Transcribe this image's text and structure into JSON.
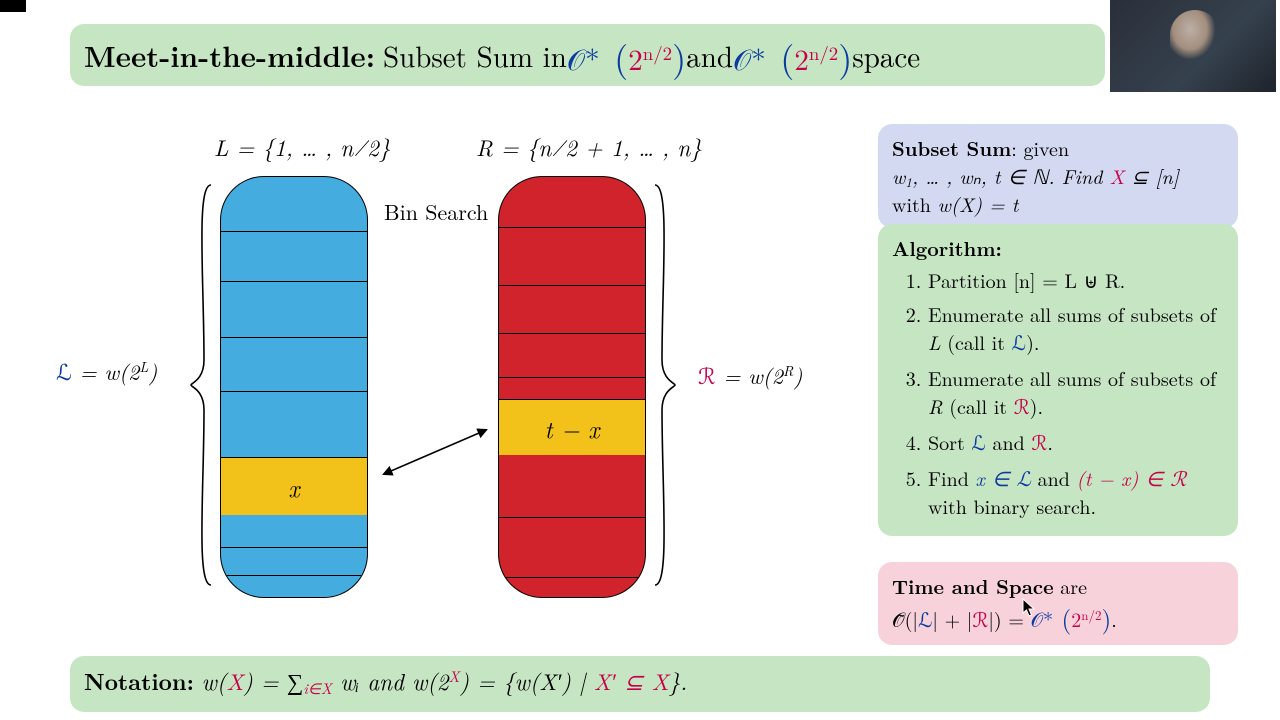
{
  "title": {
    "bold": "Meet-in-the-middle:",
    "rest_1": " Subset Sum in ",
    "o1": "𝒪*",
    "exp1": "2",
    "exp1sup": "n/2",
    "and": " and ",
    "o2": "𝒪*",
    "exp2": "2",
    "exp2sup": "n/2",
    "space": " space"
  },
  "diagram": {
    "L_label": "L = {1, … , n⁄2}",
    "R_label": "R = {n⁄2 + 1, … , n}",
    "bin_search": "Bin Search",
    "L_side_scr": "ℒ",
    "L_side_eq": " = w(2",
    "L_side_sup": "L",
    "L_side_close": ")",
    "R_side_scr": "ℛ",
    "R_side_eq": " = w(2",
    "R_side_sup": "R",
    "R_side_close": ")",
    "x_cell": "x",
    "tx_cell": "t − x"
  },
  "subset_sum": {
    "heading": "Subset Sum",
    "g": ": given",
    "w": "w",
    "line1_rest": ", … , wₙ, t ∈ ℕ. Find ",
    "X": "X",
    "subn": " ⊆ [n]",
    "line2_a": "with ",
    "line2_b": "w(X) = t"
  },
  "algo": {
    "heading": "Algorithm:",
    "i1": "Partition [n] = L ⊎ R.",
    "i2_a": "Enumerate all sums of subsets of ",
    "i2_L": "L",
    "i2_c": " (call it ",
    "i2_scrL": "ℒ",
    "i2_d": ").",
    "i3_a": "Enumerate all sums of subsets of ",
    "i3_R": "R",
    "i3_c": " (call it ",
    "i3_scrR": "ℛ",
    "i3_d": ").",
    "i4_a": "Sort ",
    "i4_L": "ℒ",
    "i4_and": " and ",
    "i4_R": "ℛ",
    "i4_dot": ".",
    "i5_a": "Find ",
    "i5_x": "x ∈ ℒ",
    "i5_and": " and ",
    "i5_tx": "(t − x) ∈ ℛ",
    "i5_rest": " with binary search."
  },
  "timespace": {
    "bold": "Time and Space",
    "are": " are",
    "otilde": "𝒪̃(|",
    "L": "ℒ",
    "plus": "| + |",
    "R": "ℛ",
    "close": "|) = ",
    "ostar": "𝒪*",
    "paren_open": " (",
    "two": "2",
    "exp": "n/2",
    "paren_close": ")",
    "dot": "."
  },
  "notation": {
    "bold": "Notation:",
    "body_a": " w(",
    "X": "X",
    "b": ") = ∑",
    "sub": "i∈X",
    "c": " wᵢ  and  w(2",
    "supX": "X",
    "d": ") = {w(X′) | ",
    "X2": "X′ ⊆ X",
    "e": "}."
  }
}
